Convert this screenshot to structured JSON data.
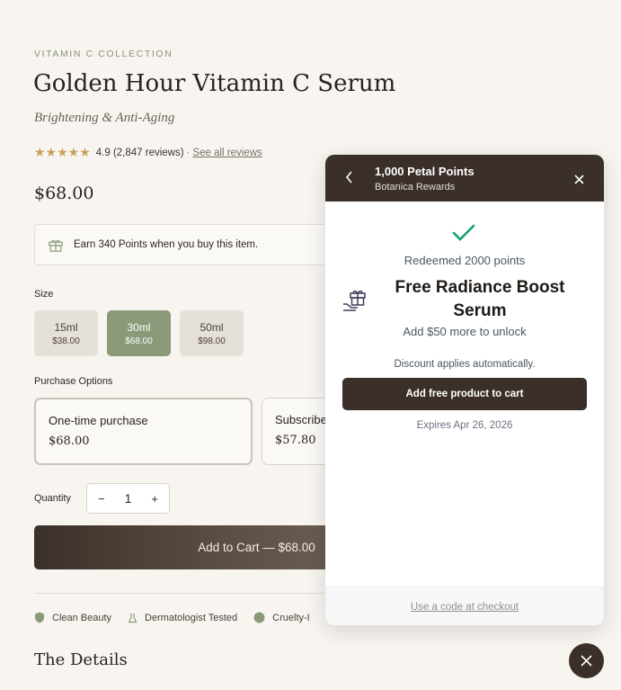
{
  "product": {
    "collection": "VITAMIN C COLLECTION",
    "title": "Golden Hour Vitamin C Serum",
    "subtitle": "Brightening & Anti-Aging",
    "stars": "★★★★★",
    "rating_value": 5,
    "rating_text": "4.9 (2,847 reviews)",
    "separator": "·",
    "reviews_link": "See all reviews",
    "price": "$68.00",
    "points_message": "Earn 340 Points when you buy this item.",
    "size_label": "Size",
    "sizes": [
      {
        "name": "15ml",
        "price": "$38.00",
        "selected": false
      },
      {
        "name": "30ml",
        "price": "$68.00",
        "selected": true
      },
      {
        "name": "50ml",
        "price": "$98.00",
        "selected": false
      }
    ],
    "purchase_label": "Purchase Options",
    "purchase_options": [
      {
        "name": "One-time purchase",
        "price": "$68.00",
        "selected": true
      },
      {
        "name": "Subscribe",
        "price": "$57.80",
        "selected": false
      }
    ],
    "quantity_label": "Quantity",
    "quantity": "1",
    "minus": "−",
    "plus": "+",
    "add_to_cart": "Add to Cart — $68.00",
    "badges": [
      "Clean Beauty",
      "Dermatologist Tested",
      "Cruelty-I"
    ],
    "details_heading": "The Details"
  },
  "rewards_panel": {
    "title": "1,000 Petal Points",
    "subtitle": "Botanica Rewards",
    "redeemed": "Redeemed 2000 points",
    "reward_name": "Free Radiance Boost Serum",
    "unlock_hint": "Add $50 more to unlock",
    "discount_note": "Discount applies automatically.",
    "add_button": "Add free product to cart",
    "expires": "Expires Apr 26, 2026",
    "footer_link": "Use a code at checkout"
  },
  "colors": {
    "background": "#f8f5f0",
    "brand_dark": "#3b3029",
    "sage": "#8a9a78",
    "star": "#c9a15a",
    "success": "#16a36b"
  },
  "icons": [
    "gift-icon",
    "back-chevron-icon",
    "close-icon",
    "checkmark-icon",
    "gift-hand-icon",
    "shield-icon",
    "flask-icon",
    "leaf-icon",
    "fab-close-icon"
  ]
}
